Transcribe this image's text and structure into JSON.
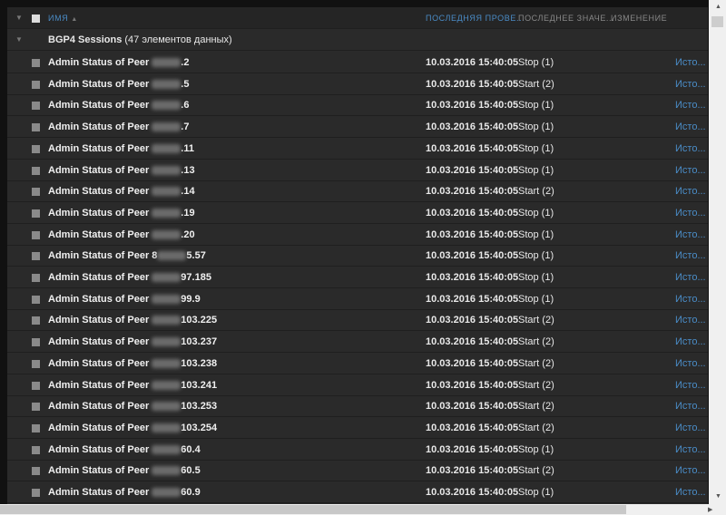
{
  "header": {
    "name_col": "ИМЯ",
    "sort_icon": "▲",
    "last_check": "ПОСЛЕДНЯЯ ПРОВЕ...",
    "last_value": "ПОСЛЕДНЕЕ ЗНАЧЕ...",
    "change": "ИЗМЕНЕНИЕ"
  },
  "group": {
    "title": "BGP4 Sessions",
    "count": " (47 элементов данных)"
  },
  "rows": [
    {
      "prefix": "Admin Status of Peer ",
      "suffix": ".2",
      "date": "10.03.2016 15:40:05",
      "value": "Stop (1)",
      "link": "Исто..."
    },
    {
      "prefix": "Admin Status of Peer ",
      "suffix": ".5",
      "date": "10.03.2016 15:40:05",
      "value": "Start (2)",
      "link": "Исто..."
    },
    {
      "prefix": "Admin Status of Peer ",
      "suffix": ".6",
      "date": "10.03.2016 15:40:05",
      "value": "Stop (1)",
      "link": "Исто..."
    },
    {
      "prefix": "Admin Status of Peer ",
      "suffix": ".7",
      "date": "10.03.2016 15:40:05",
      "value": "Stop (1)",
      "link": "Исто..."
    },
    {
      "prefix": "Admin Status of Peer ",
      "suffix": ".11",
      "date": "10.03.2016 15:40:05",
      "value": "Stop (1)",
      "link": "Исто..."
    },
    {
      "prefix": "Admin Status of Peer ",
      "suffix": ".13",
      "date": "10.03.2016 15:40:05",
      "value": "Stop (1)",
      "link": "Исто..."
    },
    {
      "prefix": "Admin Status of Peer ",
      "suffix": ".14",
      "date": "10.03.2016 15:40:05",
      "value": "Start (2)",
      "link": "Исто..."
    },
    {
      "prefix": "Admin Status of Peer ",
      "suffix": ".19",
      "date": "10.03.2016 15:40:05",
      "value": "Stop (1)",
      "link": "Исто..."
    },
    {
      "prefix": "Admin Status of Peer ",
      "suffix": ".20",
      "date": "10.03.2016 15:40:05",
      "value": "Stop (1)",
      "link": "Исто..."
    },
    {
      "prefix": "Admin Status of Peer 8",
      "suffix": "5.57",
      "date": "10.03.2016 15:40:05",
      "value": "Stop (1)",
      "link": "Исто..."
    },
    {
      "prefix": "Admin Status of Peer ",
      "suffix": "97.185",
      "date": "10.03.2016 15:40:05",
      "value": "Stop (1)",
      "link": "Исто..."
    },
    {
      "prefix": "Admin Status of Peer ",
      "suffix": "99.9",
      "date": "10.03.2016 15:40:05",
      "value": "Stop (1)",
      "link": "Исто..."
    },
    {
      "prefix": "Admin Status of Peer ",
      "suffix": "103.225",
      "date": "10.03.2016 15:40:05",
      "value": "Start (2)",
      "link": "Исто..."
    },
    {
      "prefix": "Admin Status of Peer ",
      "suffix": "103.237",
      "date": "10.03.2016 15:40:05",
      "value": "Start (2)",
      "link": "Исто..."
    },
    {
      "prefix": "Admin Status of Peer ",
      "suffix": "103.238",
      "date": "10.03.2016 15:40:05",
      "value": "Start (2)",
      "link": "Исто..."
    },
    {
      "prefix": "Admin Status of Peer ",
      "suffix": "103.241",
      "date": "10.03.2016 15:40:05",
      "value": "Start (2)",
      "link": "Исто..."
    },
    {
      "prefix": "Admin Status of Peer ",
      "suffix": "103.253",
      "date": "10.03.2016 15:40:05",
      "value": "Start (2)",
      "link": "Исто..."
    },
    {
      "prefix": "Admin Status of Peer ",
      "suffix": "103.254",
      "date": "10.03.2016 15:40:05",
      "value": "Start (2)",
      "link": "Исто..."
    },
    {
      "prefix": "Admin Status of Peer ",
      "suffix": "60.4",
      "date": "10.03.2016 15:40:05",
      "value": "Stop (1)",
      "link": "Исто..."
    },
    {
      "prefix": "Admin Status of Peer ",
      "suffix": "60.5",
      "date": "10.03.2016 15:40:05",
      "value": "Start (2)",
      "link": "Исто..."
    },
    {
      "prefix": "Admin Status of Peer ",
      "suffix": "60.9",
      "date": "10.03.2016 15:40:05",
      "value": "Stop (1)",
      "link": "Исто..."
    }
  ]
}
